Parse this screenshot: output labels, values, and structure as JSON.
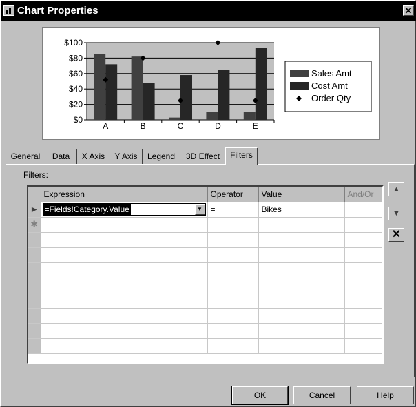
{
  "window": {
    "title": "Chart Properties",
    "close_glyph": "✕"
  },
  "chart_data": {
    "type": "bar",
    "categories": [
      "A",
      "B",
      "C",
      "D",
      "E"
    ],
    "series": [
      {
        "name": "Sales Amt",
        "values": [
          85,
          82,
          3,
          10,
          10
        ],
        "color": "#404040"
      },
      {
        "name": "Cost Amt",
        "values": [
          72,
          48,
          58,
          65,
          93
        ],
        "color": "#262626"
      }
    ],
    "markers": {
      "name": "Order Qty",
      "values": [
        52,
        80,
        25,
        100,
        25
      ],
      "marker": "diamond",
      "color": "#000000"
    },
    "yticks": [
      "$0",
      "$20",
      "$40",
      "$60",
      "$80",
      "$100"
    ],
    "ylim": [
      0,
      100
    ],
    "grid": true,
    "legend_position": "right",
    "plot_background": "#c0c0c0"
  },
  "tabs": [
    {
      "label": "General",
      "active": false
    },
    {
      "label": "Data",
      "active": false
    },
    {
      "label": "X Axis",
      "active": false
    },
    {
      "label": "Y Axis",
      "active": false
    },
    {
      "label": "Legend",
      "active": false
    },
    {
      "label": "3D Effect",
      "active": false
    },
    {
      "label": "Filters",
      "active": true
    }
  ],
  "filters": {
    "label": "Filters:",
    "columns": [
      "Expression",
      "Operator",
      "Value",
      "And/Or"
    ],
    "rows": [
      {
        "expression": "=Fields!Category.Value",
        "operator": "=",
        "value": "Bikes",
        "andor": ""
      }
    ],
    "row_indicator_icon": "current-row-arrow-icon",
    "new_row_icon": "new-row-asterisk-icon"
  },
  "side_buttons": [
    "move-up-icon",
    "move-down-icon",
    "delete-icon"
  ],
  "buttons": {
    "ok": "OK",
    "cancel": "Cancel",
    "help": "Help"
  }
}
